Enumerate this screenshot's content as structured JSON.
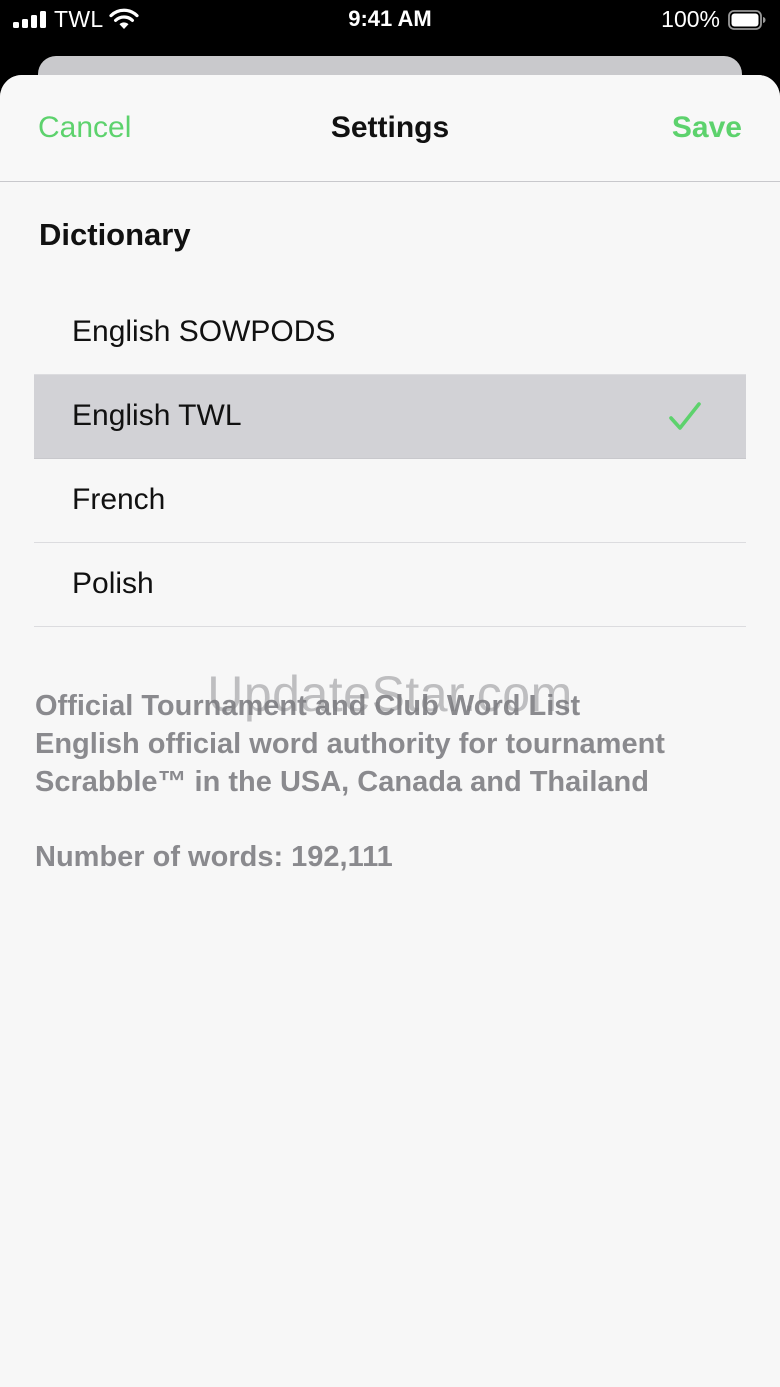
{
  "status_bar": {
    "carrier": "TWL",
    "time": "9:41 AM",
    "battery": "100%"
  },
  "nav": {
    "cancel": "Cancel",
    "title": "Settings",
    "save": "Save"
  },
  "dictionary": {
    "header": "Dictionary",
    "items": [
      {
        "label": "English SOWPODS",
        "selected": false
      },
      {
        "label": "English TWL",
        "selected": true
      },
      {
        "label": "French",
        "selected": false
      },
      {
        "label": "Polish",
        "selected": false
      }
    ]
  },
  "details": {
    "line1": "Official Tournament and Club Word List",
    "line2": "English official word authority for tournament",
    "line3": "Scrabble™ in the USA, Canada and Thailand",
    "word_count": "Number of words: 192,111"
  },
  "watermark": "UpdateStar.com",
  "colors": {
    "accent": "#5dd26d",
    "selected_row": "#d2d2d6",
    "secondary_text": "#8a8a8e"
  }
}
